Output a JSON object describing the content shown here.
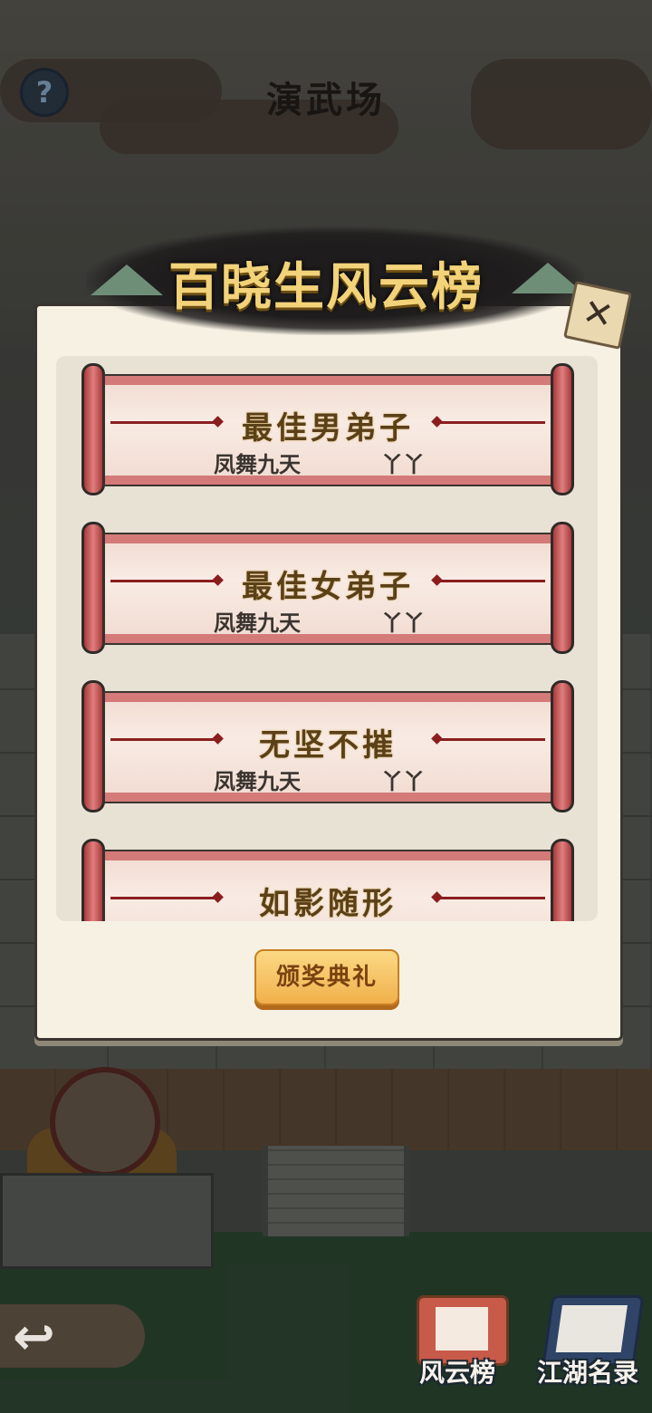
{
  "header": {
    "title": "演武场",
    "help_glyph": "?"
  },
  "dialog": {
    "title": "百晓生风云榜",
    "close_glyph": "✕",
    "awards": [
      {
        "title": "最佳男弟子",
        "winner_a": "凤舞九天",
        "winner_b": "丫丫"
      },
      {
        "title": "最佳女弟子",
        "winner_a": "凤舞九天",
        "winner_b": "丫丫"
      },
      {
        "title": "无坚不摧",
        "winner_a": "凤舞九天",
        "winner_b": "丫丫"
      },
      {
        "title": "如影随形",
        "winner_a": "",
        "winner_b": ""
      }
    ],
    "ceremony_button": "颁奖典礼"
  },
  "bottom_nav": {
    "back_glyph": "↩",
    "items": [
      {
        "label": "风云榜",
        "icon": "scroll-icon"
      },
      {
        "label": "江湖名录",
        "icon": "book-icon"
      }
    ]
  },
  "colors": {
    "accent": "#f1b04b",
    "scroll_red": "#d47a78",
    "title_gold": "#f3d37a"
  }
}
